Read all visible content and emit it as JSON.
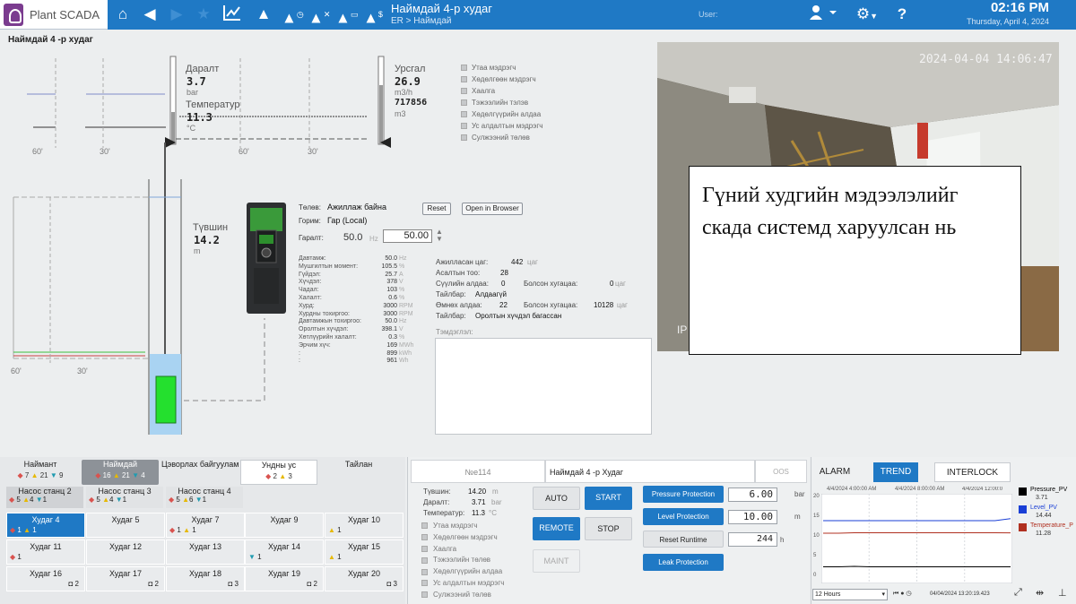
{
  "topbar": {
    "app_name": "Plant SCADA",
    "screen_title": "Наймдай 4-р худаг",
    "breadcrumb": "ER > Наймдай",
    "user_label": "User:",
    "time": "02:16 PM",
    "date": "Thursday, April 4, 2024"
  },
  "page_title": "Наймдай 4 -р худаг",
  "upper_chart": {
    "x_ticks": [
      "60'",
      "30'",
      "60'",
      "30'"
    ],
    "pressure_label": "Даралт",
    "pressure_value": "3.7",
    "pressure_unit": "bar",
    "temperature_label": "Температур",
    "temperature_value": "11.3",
    "temperature_unit": "°C",
    "flow_label": "Урсгал",
    "flow_value": "26.9",
    "flow_unit": "m3/h",
    "total_value": "717856",
    "total_unit": "m3"
  },
  "status_list": [
    "Утаа мэдрэгч",
    "Хөдөлгөөн мэдрэгч",
    "Хаалга",
    "Тэжээлийн тэлэв",
    "Хөдөлгүүрийн алдаа",
    "Ус алдалтын мэдрэгч",
    "Сулжээний төлөв"
  ],
  "level": {
    "label": "Түвшин",
    "value": "14.2",
    "unit": "m",
    "x_ticks": [
      "60'",
      "30'"
    ]
  },
  "vfd": {
    "state_label": "Төлөв:",
    "state_value": "Ажиллаж байна",
    "mode_label": "Горим:",
    "mode_value": "Гар (Local)",
    "output_label": "Гаралт:",
    "output_value": "50.0",
    "output_unit": "Hz",
    "output_setpoint": "50.00",
    "reset_label": "Reset",
    "browser_label": "Open in Browser",
    "params": [
      {
        "label": "Давтамж:",
        "value": "50.0",
        "unit": "Hz"
      },
      {
        "label": "Мушгилтын момент:",
        "value": "105.5",
        "unit": "%"
      },
      {
        "label": "Гүйдэл:",
        "value": "25.7",
        "unit": "A"
      },
      {
        "label": "Хүчдэл:",
        "value": "378",
        "unit": "V"
      },
      {
        "label": "Чадал:",
        "value": "103",
        "unit": "%"
      },
      {
        "label": "Халалт:",
        "value": "0.6",
        "unit": "%"
      },
      {
        "label": "Хурд:",
        "value": "3000",
        "unit": "RPM"
      },
      {
        "label": "Хурдны тохиргоо:",
        "value": "3000",
        "unit": "RPM"
      },
      {
        "label": "Давтамжын тохиргоо:",
        "value": "50.0",
        "unit": "Hz"
      },
      {
        "label": "Оролтын хүчдэл:",
        "value": "398.1",
        "unit": "V"
      },
      {
        "label": "Хөтлүүрийн халалт:",
        "value": "0.3",
        "unit": "%"
      },
      {
        "label": "Эрчим хүч:",
        "value": "169",
        "unit": "MWh"
      },
      {
        "label": ":",
        "value": "899",
        "unit": "kWh"
      },
      {
        "label": ":",
        "value": "961",
        "unit": "Wh"
      }
    ],
    "runtime_label": "Ажилласан цаг:",
    "runtime_value": "442",
    "runtime_unit": "цаг",
    "starts_label": "Асалтын тоо:",
    "starts_value": "28",
    "net_err_label": "Сүүлийн алдаа:",
    "net_err_value": "0",
    "since_label": "Болсон хугацаа:",
    "since_value": "0",
    "since_unit": "цаг",
    "note1_label": "Тайлбар:",
    "note1_value": "Алдаагүй",
    "prev_err_label": "Өмнөх алдаа:",
    "prev_err_value": "22",
    "prev_since_label": "Болсон хугацаа:",
    "prev_since_value": "10128",
    "prev_since_unit": "цаг",
    "note2_label": "Тайлбар:",
    "note2_value": "Оролтын хүчдэл багассан",
    "notes_label": "Тэмдэглэл:"
  },
  "camera": {
    "timestamp": "2024-04-04 14:06:47",
    "overlay": "IP"
  },
  "caption": "Гүний худгийн мэдээлэлийг скада системд харуулсан нь",
  "nav": {
    "tabs": [
      {
        "label": "Наймант",
        "r": "7",
        "y": "21",
        "b": "9"
      },
      {
        "label": "Наймдай",
        "r": "16",
        "y": "21",
        "b": "4"
      },
      {
        "label": "Цэворлах байгууламж",
        "r": "",
        "y": "",
        "b": ""
      },
      {
        "label": "Ундны ус",
        "r": "2",
        "y": "3",
        "b": ""
      },
      {
        "label": "Тайлан",
        "r": "",
        "y": "",
        "b": ""
      }
    ],
    "groups": [
      {
        "label": "Насос станц 2",
        "a": "5",
        "y": "4",
        "b": "1"
      },
      {
        "label": "Насос станц 3",
        "a": "5",
        "y": "4",
        "b": "1"
      },
      {
        "label": "Насос станц 4",
        "a": "5",
        "y": "6",
        "b": "1"
      }
    ],
    "wells": [
      {
        "label": "Худаг 4",
        "c1": "1",
        "c2": "1"
      },
      {
        "label": "Худаг 5",
        "c1": "",
        "c2": ""
      },
      {
        "label": "Худаг 7",
        "c1": "1",
        "c2": "1"
      },
      {
        "label": "Худаг 9",
        "c1": "",
        "c2": ""
      },
      {
        "label": "Худаг 10",
        "c1": "",
        "c2": "1"
      },
      {
        "label": "Худаг 11",
        "c1": "1",
        "c2": ""
      },
      {
        "label": "Худаг 12",
        "c1": "",
        "c2": ""
      },
      {
        "label": "Худаг 13",
        "c1": "",
        "c2": ""
      },
      {
        "label": "Худаг 14",
        "c1": "",
        "c2": "1"
      },
      {
        "label": "Худаг 15",
        "c1": "",
        "c2": "1"
      },
      {
        "label": "Худаг 16",
        "c1": "",
        "c2": "2"
      },
      {
        "label": "Худаг 17",
        "c1": "",
        "c2": "2"
      },
      {
        "label": "Худаг 18",
        "c1": "",
        "c2": "3"
      },
      {
        "label": "Худаг 19",
        "c1": "",
        "c2": "2"
      },
      {
        "label": "Худаг 20",
        "c1": "",
        "c2": "3"
      }
    ]
  },
  "well_panel": {
    "id": "№е114",
    "name": "Наймдай 4 -р Худаг",
    "oos": "OOS",
    "level_label": "Түвшин:",
    "level_value": "14.20",
    "level_unit": "m",
    "pressure_label": "Даралт:",
    "pressure_value": "3.71",
    "pressure_unit": "bar",
    "temp_label": "Температур:",
    "temp_value": "11.3",
    "temp_unit": "°C",
    "checks": [
      "Утаа мэдрэгч",
      "Хөдөлгөөн мэдрэгч",
      "Хаалга",
      "Тэжээлийн төлөв",
      "Хөдөлгүүрийн алдаа",
      "Ус алдалтын мэдрэгч",
      "Сулжээний төлөв"
    ],
    "auto": "AUTO",
    "start": "START",
    "remote": "REMOTE",
    "stop": "STOP",
    "maint": "MAINT",
    "pressure_prot": "Pressure Protection",
    "pressure_set": "6.00",
    "pressure_set_unit": "bar",
    "level_prot": "Level Protection",
    "level_set": "10.00",
    "level_set_unit": "m",
    "reset_runtime": "Reset Runtime",
    "runtime_set": "244",
    "runtime_unit": "h",
    "leak_prot": "Leak Protection"
  },
  "trend": {
    "tabs": [
      "ALARM",
      "TREND",
      "INTERLOCK"
    ],
    "time_labels": [
      "4/4/2024 4:00:00 AM",
      "4/4/2024 8:00:00 AM",
      "4/4/2024 12:00:0"
    ],
    "y_ticks": [
      "20",
      "15",
      "10",
      "5",
      "0"
    ],
    "legend": [
      {
        "name": "Pressure_PV",
        "value": "3.71",
        "color": "#000000"
      },
      {
        "name": "Level_PV",
        "value": "14.44",
        "color": "#1a3fd6"
      },
      {
        "name": "Temperature_P",
        "value": "11.28",
        "color": "#b03020"
      }
    ],
    "range": "12 Hours",
    "cursor_time": "04/04/2024 13:20:19.423"
  },
  "chart_data": {
    "type": "line",
    "x": [
      0,
      1,
      2,
      3,
      4,
      5,
      6,
      7,
      8,
      9,
      10,
      11,
      12
    ],
    "series": [
      {
        "name": "Pressure_PV",
        "color": "#000000",
        "values": [
          3.7,
          3.7,
          3.8,
          3.7,
          3.7,
          3.7,
          3.7,
          3.7,
          3.7,
          3.7,
          3.7,
          3.7,
          3.71
        ]
      },
      {
        "name": "Level_PV",
        "color": "#1a3fd6",
        "values": [
          14,
          14,
          14,
          14,
          14,
          14,
          14,
          14,
          14,
          14,
          14,
          14,
          14.44
        ]
      },
      {
        "name": "Temperature_P",
        "color": "#b03020",
        "values": [
          11.2,
          11.2,
          11.3,
          11.3,
          11.3,
          11.3,
          11.3,
          11.3,
          11.3,
          11.3,
          11.3,
          11.3,
          11.28
        ]
      }
    ],
    "ylim": [
      0,
      20
    ]
  }
}
